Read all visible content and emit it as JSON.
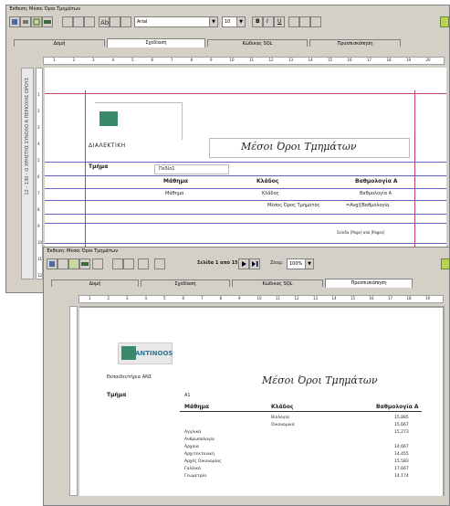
{
  "window1": {
    "title": "Έκθεση: Μέσοι Όροι Τμημάτων",
    "font_name": "Arial",
    "font_size": "10",
    "format_buttons": [
      "B",
      "I",
      "U"
    ],
    "tabs": [
      "Δομή",
      "Σχεδίαση",
      "Κώδικας SQL",
      "Προεπισκόπηση"
    ],
    "active_tab": 1,
    "ruler_marks": [
      "1",
      "2",
      "3",
      "4",
      "5",
      "6",
      "7",
      "8",
      "9",
      "10",
      "11",
      "12",
      "13",
      "14",
      "15",
      "16",
      "17",
      "18",
      "19",
      "20"
    ],
    "vruler_text": "12 - 130 - Ο ΧΡΗΣΤΗΣ ΣΥΝΟΛΟ Α ΠΕΡΙΟΧΗΣ ΟΡΟΥΣ",
    "logo_text": "ΔΙΑΛΕΚΤΙΚΗ",
    "report_title": "Μέσοι Όροι Τμημάτων",
    "label_tmima": "Τμήμα",
    "field_tmima": "Πεδίο1",
    "col_headers": [
      "Μάθημα",
      "Κλάδος",
      "Βαθμολογία Α"
    ],
    "row_values": [
      "Μάθημα",
      "Κλάδος",
      "Βαθμολογία Α"
    ],
    "footer_label": "Μέσος Όρος Τμήματος",
    "footer_value": "=Avg([Βαθμολογία",
    "page_footer": "Σελίδα [Page] από [Pages]"
  },
  "window2": {
    "title": "Έκθεση: Μέσοι Όροι Τμημάτων",
    "page_label": "Σελίδα 1 από 15",
    "zoom_label": "Ζουμ:",
    "zoom_value": "100%",
    "tabs": [
      "Δομή",
      "Σχεδίαση",
      "Κώδικας SQL",
      "Προεπισκόπηση"
    ],
    "active_tab": 3,
    "ruler_marks": [
      "1",
      "2",
      "3",
      "4",
      "5",
      "6",
      "7",
      "8",
      "9",
      "10",
      "11",
      "12",
      "13",
      "14",
      "15",
      "16",
      "17",
      "18",
      "19"
    ],
    "logo_text": "ANTINOOS",
    "company": "Εκπαιδευτήρια ΑΝΣ",
    "report_title": "Μέσοι Όροι Τμημάτων",
    "label_tmima": "Τμήμα",
    "tmima_value": "Α1",
    "col_headers": [
      "Μάθημα",
      "Κλάδος",
      "Βαθμολογία Α"
    ],
    "rows": [
      {
        "m": "",
        "k": "Βιολογία",
        "v": "15,885"
      },
      {
        "m": "",
        "k": "Οικονομικά",
        "v": "15,667"
      },
      {
        "m": "Αγγλικά",
        "k": "",
        "v": "15,273"
      },
      {
        "m": "Ανθρωπολογία",
        "k": "",
        "v": ""
      },
      {
        "m": "Αρχαία",
        "k": "",
        "v": "14,667"
      },
      {
        "m": "Αρχιτεκτονική",
        "k": "",
        "v": "14,455"
      },
      {
        "m": "Αρχές Οικονομίας",
        "k": "",
        "v": "15,583"
      },
      {
        "m": "Γαλλικά",
        "k": "",
        "v": "17,667"
      },
      {
        "m": "Γεωμετρία",
        "k": "",
        "v": "14,174"
      }
    ]
  }
}
